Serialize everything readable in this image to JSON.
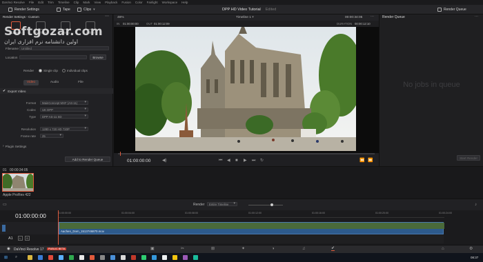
{
  "menubar": {
    "items": [
      "DaVinci Resolve",
      "File",
      "Edit",
      "Trim",
      "Timeline",
      "Clip",
      "Mark",
      "View",
      "Playback",
      "Fusion",
      "Color",
      "Fairlight",
      "Workspace",
      "Help"
    ]
  },
  "toolbar": {
    "render_settings_label": "Render Settings",
    "tape_label": "Tape",
    "clips_label": "Clips",
    "project_title": "DPP HD Video Tutorial",
    "edited_label": "Edited",
    "render_queue_label": "Render Queue"
  },
  "render_settings": {
    "panel_title": "Render Settings - Custom",
    "presets": [
      "Custom",
      "YouTube",
      "Vimeo",
      "Twitter"
    ],
    "filename_label": "Filename",
    "filename_value": "Untitled",
    "location_label": "Location",
    "browse_label": "Browse",
    "render_label": "Render",
    "single_clip_label": "Single clip",
    "individual_clips_label": "Individual clips",
    "tabs": [
      "Video",
      "Audio",
      "File"
    ],
    "export_video_label": "Export Video",
    "format_label": "Format",
    "format_value": "MainConcept MXF (AS-11)",
    "codec_label": "Codec",
    "codec_value": "UK DPP",
    "type_label": "Type",
    "type_value": "DPP AS-11 SD",
    "resolution_label": "Resolution",
    "resolution_value": "1280 x 720 HD 720P",
    "frame_rate_label": "Frame rate",
    "frame_rate_value": "25",
    "plugin_settings_label": "Plugin Settings",
    "add_to_queue_label": "Add to Render Queue"
  },
  "viewer": {
    "zoom": "46%",
    "timeline_name": "Timeline 1",
    "timecode_top": "00:00:34:05",
    "in_label": "IN",
    "in_value": "01:00:00:00",
    "out_label": "OUT",
    "out_value": "01:00:12:09",
    "duration_label": "DURATION",
    "duration_value": "00:00:12:10",
    "current_timecode": "01:00:00:00"
  },
  "render_queue": {
    "title": "Render Queue",
    "empty_message": "No jobs in queue",
    "start_render_label": "Start Render"
  },
  "media_pool": {
    "clip_index": "01",
    "clip_timecode": "00:00:34:05",
    "clip_name": "Apple ProRes 422"
  },
  "timeline": {
    "timecode": "01:00:00:00",
    "render_label": "Render",
    "render_range": "Entire Timeline",
    "track_name": "A1",
    "clip_name": "Aachen_Dom_1513746870.mov",
    "ruler_marks": [
      "01:00:00:00",
      "01:00:04:00",
      "01:00:08:00",
      "01:00:12:00",
      "01:00:16:00",
      "01:00:20:00",
      "01:00:24:00"
    ]
  },
  "footer": {
    "app_name": "DaVinci Resolve 17",
    "badge": "PUBLIC BETA"
  },
  "watermark": {
    "brand": "Softgozar.com",
    "tagline": "اولین دانشنامه نرم افزاری ایران"
  },
  "taskbar": {
    "time": "08:37"
  },
  "colors": {
    "accent": "#e05a3c",
    "playhead": "#e05a3c",
    "clip_fill": "#2d5a8c",
    "background": "#1c1c1e"
  }
}
